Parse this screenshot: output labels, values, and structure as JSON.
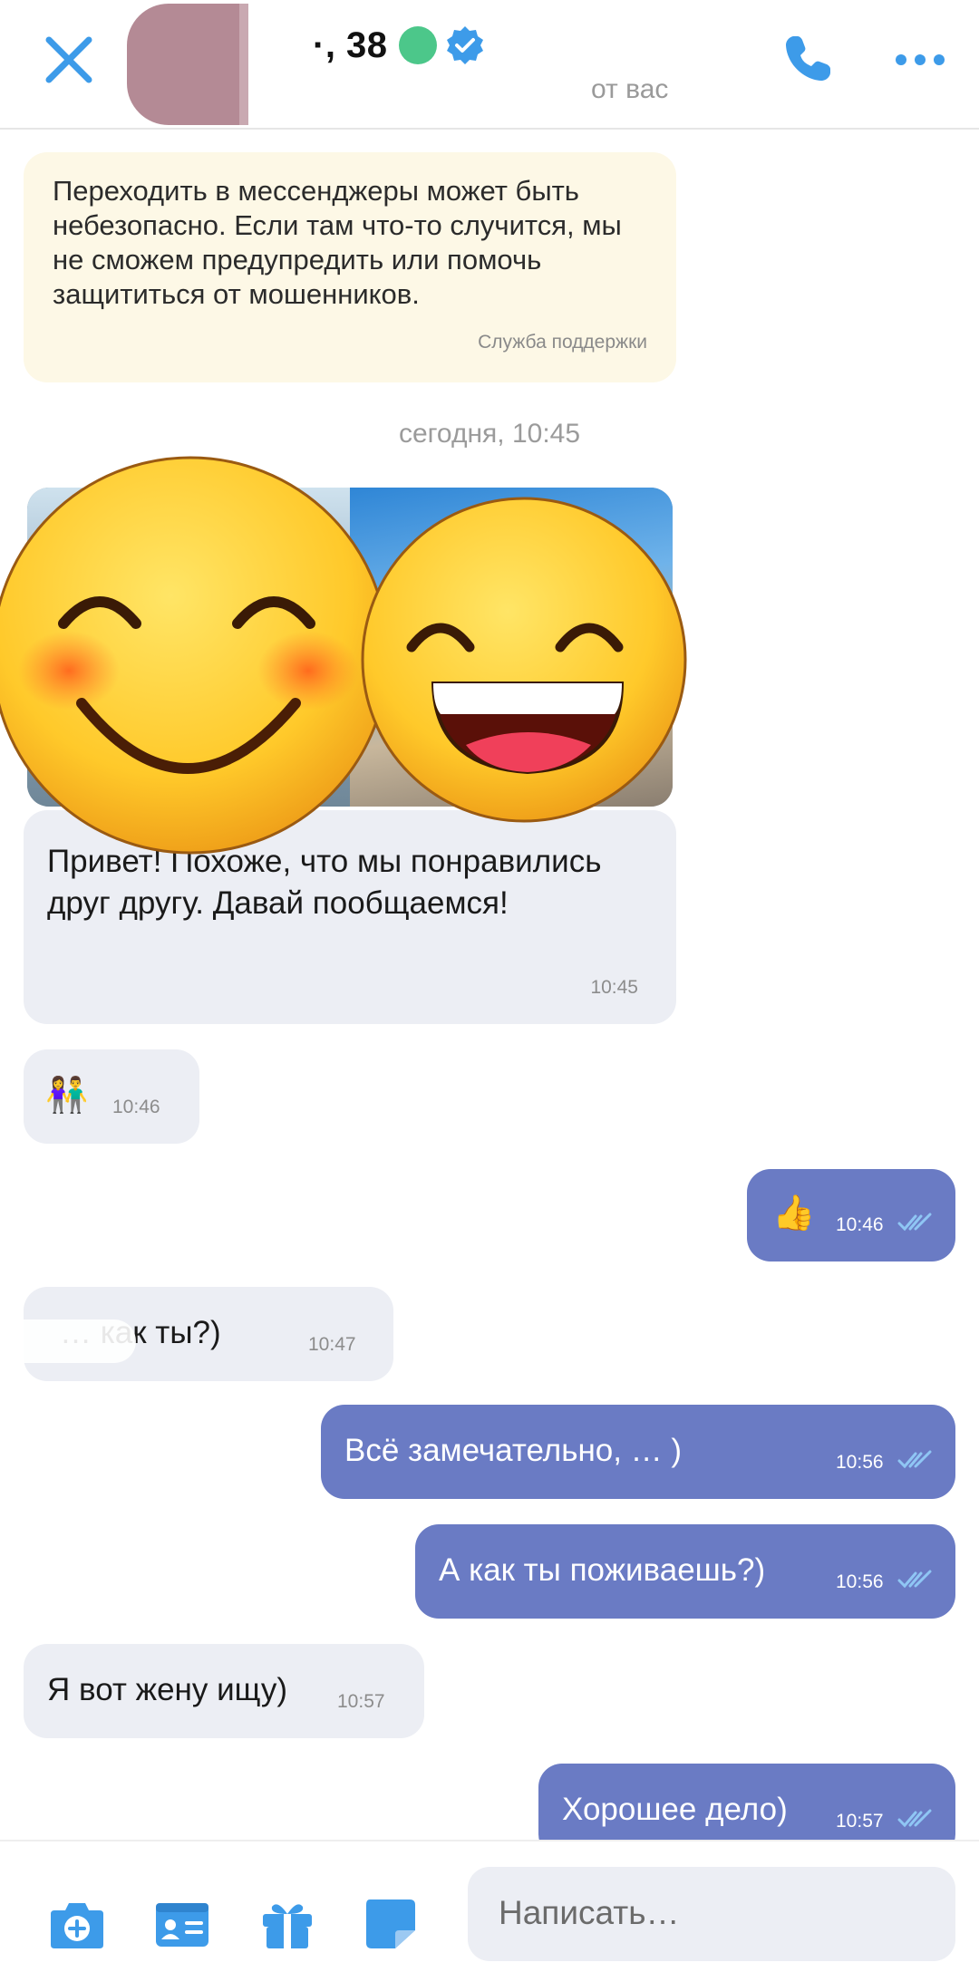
{
  "header": {
    "name": "·, 38",
    "subtitle": "от вас",
    "accent_color": "#3d9be9",
    "online_color": "#4cc78a",
    "icons": [
      "close-icon",
      "avatar",
      "online-indicator",
      "verified-badge-icon",
      "phone-icon",
      "more-icon"
    ]
  },
  "notice": {
    "text": "Переходить в мессенджеры может быть небезопасно. Если там что-то случится, мы не сможем предупредить или помочь защититься от мошенников.",
    "sender": "Служба поддержки"
  },
  "date_separator": "сегодня, 10:45",
  "messages": [
    {
      "side": "in",
      "text": "Привет! Похоже, что мы понравились друг другу. Давай пообщаемся!",
      "time": "10:45"
    },
    {
      "side": "in",
      "text": "👫",
      "time": "10:46"
    },
    {
      "side": "out",
      "text": "👍",
      "time": "10:46"
    },
    {
      "side": "in",
      "text": "… как ты?)",
      "time": "10:47"
    },
    {
      "side": "out",
      "text": "Всё замечательно, … )",
      "time": "10:56"
    },
    {
      "side": "out",
      "text": "А как ты поживаешь?)",
      "time": "10:56"
    },
    {
      "side": "in",
      "text": "Я вот жену ищу)",
      "time": "10:57"
    },
    {
      "side": "out",
      "text": "Хорошее дело)",
      "time": "10:57"
    }
  ],
  "composer": {
    "placeholder": "Написать…",
    "tools": [
      "camera-icon",
      "contact-card-icon",
      "gift-icon",
      "sticker-icon"
    ]
  },
  "colors": {
    "outgoing_bubble": "#6a7bc4",
    "incoming_bubble": "#eceef4",
    "notice_bubble": "#fdf8e6"
  }
}
